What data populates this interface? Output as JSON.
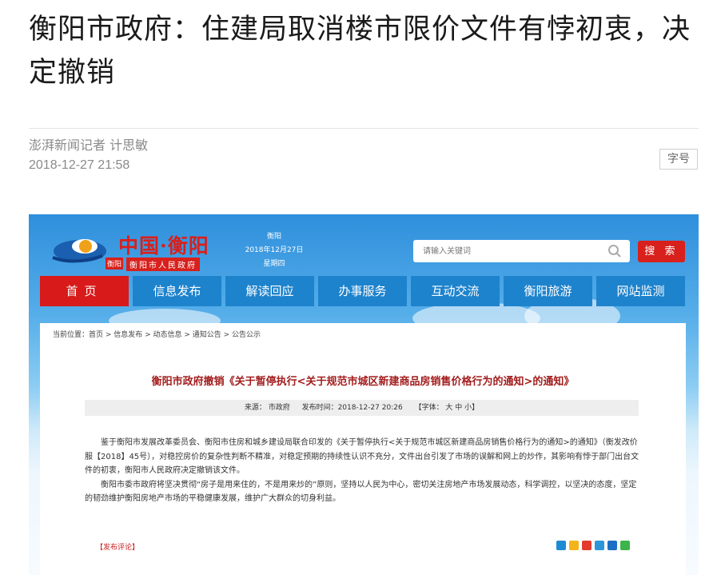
{
  "article": {
    "title": "衡阳市政府：住建局取消楼市限价文件有悖初衷，决定撤销",
    "author": "澎湃新闻记者 计思敏",
    "date": "2018-12-27 21:58",
    "font_size_label": "字号"
  },
  "screenshot": {
    "logo": {
      "main": "中国·衡阳",
      "sub": "衡阳市人民政府",
      "side": "衡阳"
    },
    "date_block": {
      "city": "衡阳",
      "date": "2018年12月27日",
      "weekday": "星期四"
    },
    "search": {
      "placeholder": "请输入关键词",
      "button": "搜 索"
    },
    "nav": [
      "首页",
      "信息发布",
      "解读回应",
      "办事服务",
      "互动交流",
      "衡阳旅游",
      "网站监测"
    ],
    "breadcrumb": "当前位置：首页 > 信息发布 > 动态信息 > 通知公告 > 公告公示",
    "notice_title": "衡阳市政府撤销《关于暂停执行<关于规范市城区新建商品房销售价格行为的通知>的通知》",
    "meta": {
      "source": "来源：  市政府",
      "time": "发布时间：2018-12-27 20:26",
      "fontsize": "【字体： 大 中 小】"
    },
    "paragraphs": [
      "鉴于衡阳市发展改革委员会、衡阳市住房和城乡建设局联合印发的《关于暂停执行<关于规范市城区新建商品房销售价格行为的通知>的通知》（衡发改价服【2018】45号），对稳控房价的复杂性判断不精准，对稳定预期的持续性认识不充分，文件出台引发了市场的误解和网上的炒作，其影响有悖于部门出台文件的初衷，衡阳市人民政府决定撤销该文件。",
      "衡阳市委市政府将坚决贯彻“房子是用来住的，不是用来炒的”原则，坚持以人民为中心，密切关注房地产市场发展动态，科学调控，以坚决的态度，坚定的韧劲维护衡阳房地产市场的平稳健康发展，维护广大群众的切身利益。"
    ],
    "comment_link": "【发布评论】",
    "share_icons": [
      {
        "name": "share-plus-icon",
        "color": "#1d8ad6"
      },
      {
        "name": "share-qzone-icon",
        "color": "#f3b41b"
      },
      {
        "name": "share-weibo-icon",
        "color": "#e23b2e"
      },
      {
        "name": "share-tqq-icon",
        "color": "#2d96d9"
      },
      {
        "name": "share-renren-icon",
        "color": "#1d6fc4"
      },
      {
        "name": "share-wechat-icon",
        "color": "#3bb54a"
      }
    ],
    "colors": {
      "nav_blue": "#1e83cd",
      "nav_active": "#d81a1a",
      "title_red": "#a31d1d"
    }
  }
}
